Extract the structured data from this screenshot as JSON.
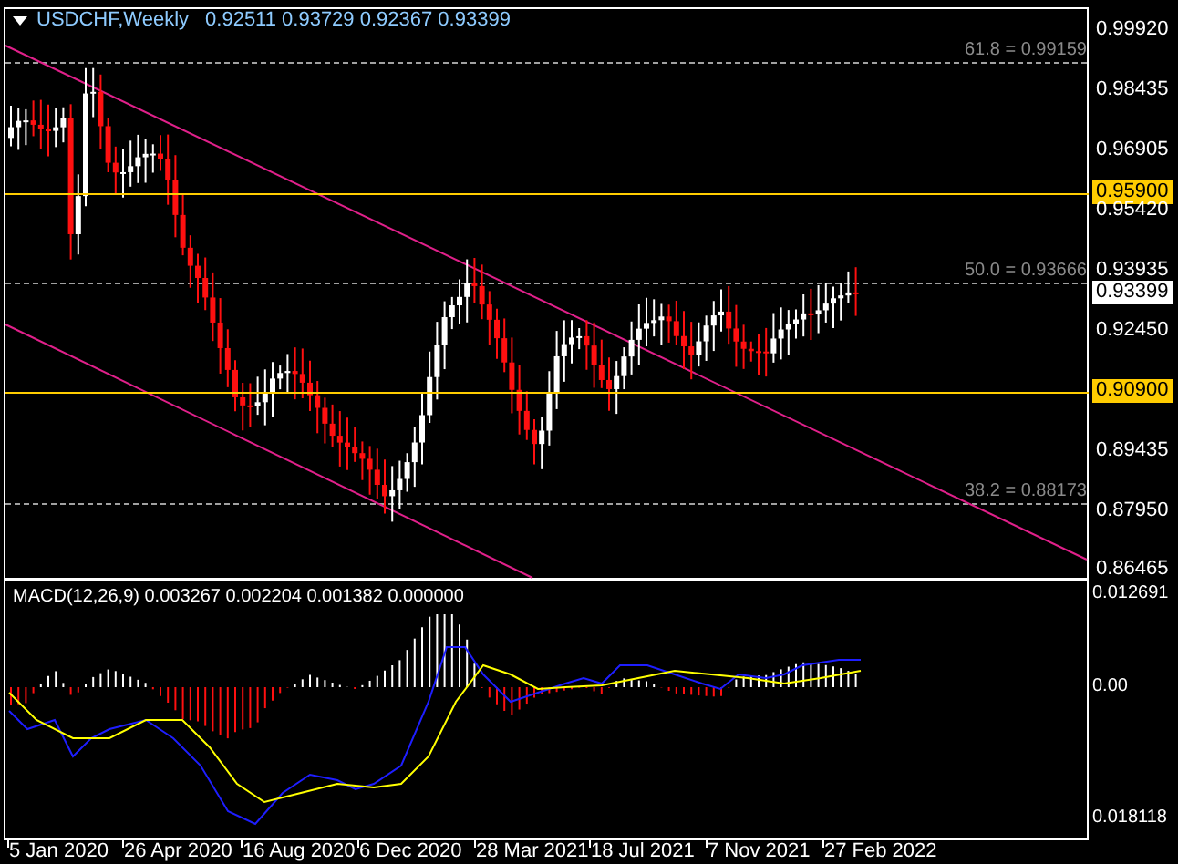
{
  "chart": {
    "title": "USDCHF,Weekly",
    "ohlc": "0.92511 0.93729 0.92367 0.93399",
    "price_axis": [
      {
        "label": "0.99920",
        "kind": "plain"
      },
      {
        "label": "0.98435",
        "kind": "plain"
      },
      {
        "label": "0.96905",
        "kind": "plain"
      },
      {
        "label": "0.95900",
        "kind": "level"
      },
      {
        "label": "0.95420",
        "kind": "plain"
      },
      {
        "label": "0.93935",
        "kind": "plain"
      },
      {
        "label": "0.93399",
        "kind": "bid"
      },
      {
        "label": "0.92450",
        "kind": "plain"
      },
      {
        "label": "0.90900",
        "kind": "level"
      },
      {
        "label": "0.89435",
        "kind": "plain"
      },
      {
        "label": "0.87950",
        "kind": "plain"
      },
      {
        "label": "0.86465",
        "kind": "plain"
      }
    ],
    "fib_levels": [
      {
        "label": "61.8 = 0.99159"
      },
      {
        "label": "50.0 = 0.93666"
      },
      {
        "label": "38.2 = 0.88173"
      }
    ]
  },
  "indicator": {
    "title": "MACD(12,26,9) 0.003267 0.002204 0.001382 0.000000",
    "axis": [
      "0.012691",
      "0.00",
      "0.018118"
    ]
  },
  "time_axis": [
    "5 Jan 2020",
    "26 Apr 2020",
    "16 Aug 2020",
    "6 Dec 2020",
    "28 Mar 2021",
    "18 Jul 2021",
    "7 Nov 2021",
    "27 Feb 2022"
  ]
}
